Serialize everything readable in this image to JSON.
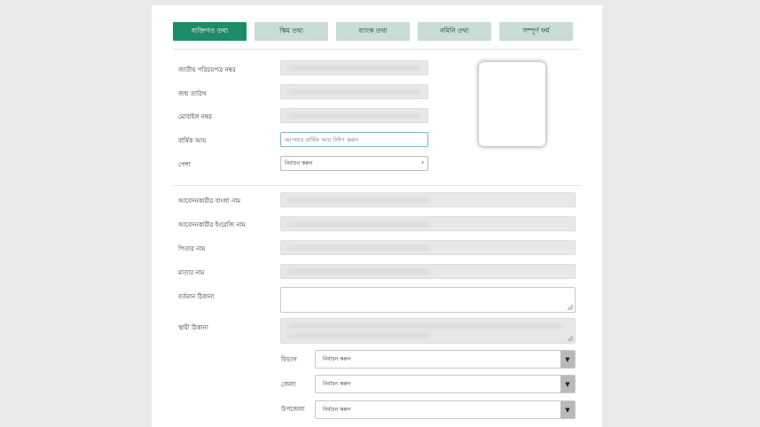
{
  "tabs": [
    {
      "label": "ব্যক্তিগত তথ্য",
      "active": true
    },
    {
      "label": "স্কিম তথ্য",
      "active": false
    },
    {
      "label": "ব্যাংক তথ্য",
      "active": false
    },
    {
      "label": "নমিনি তথ্য",
      "active": false
    },
    {
      "label": "সম্পূর্ণ ফর্ম",
      "active": false
    }
  ],
  "personal": {
    "nid_label": "জাতীয় পরিচয়পত্র নম্বর",
    "dob_label": "জন্ম তারিখ",
    "mobile_label": "মোবাইল নম্বর",
    "income_label": "বার্ষিক আয়",
    "income_placeholder": "আপনার বার্ষিক আয় টাইপ করুন",
    "profession_label": "পেশা",
    "profession_value": "নির্বাচন করুন"
  },
  "applicant": {
    "bn_name_label": "আবেদনকারীর বাংলা নাম",
    "en_name_label": "আবেদনকারীর ইংরেজি নাম",
    "father_label": "পিতার নাম",
    "mother_label": "মাতার নাম",
    "present_address_label": "বর্তমান ঠিকানা",
    "permanent_address_label": "স্থায়ী ঠিকানা",
    "division_label": "বিভাগ",
    "division_value": "নির্বাচন করুন",
    "district_label": "জেলা",
    "district_value": "নির্বাচন করুন",
    "upazila_label": "উপজেলা",
    "upazila_value": "নির্বাচন করুন"
  },
  "colors": {
    "active_tab": "#1d8a68",
    "inactive_tab": "#c9dcd6",
    "focus_border": "#7fb5c8"
  }
}
